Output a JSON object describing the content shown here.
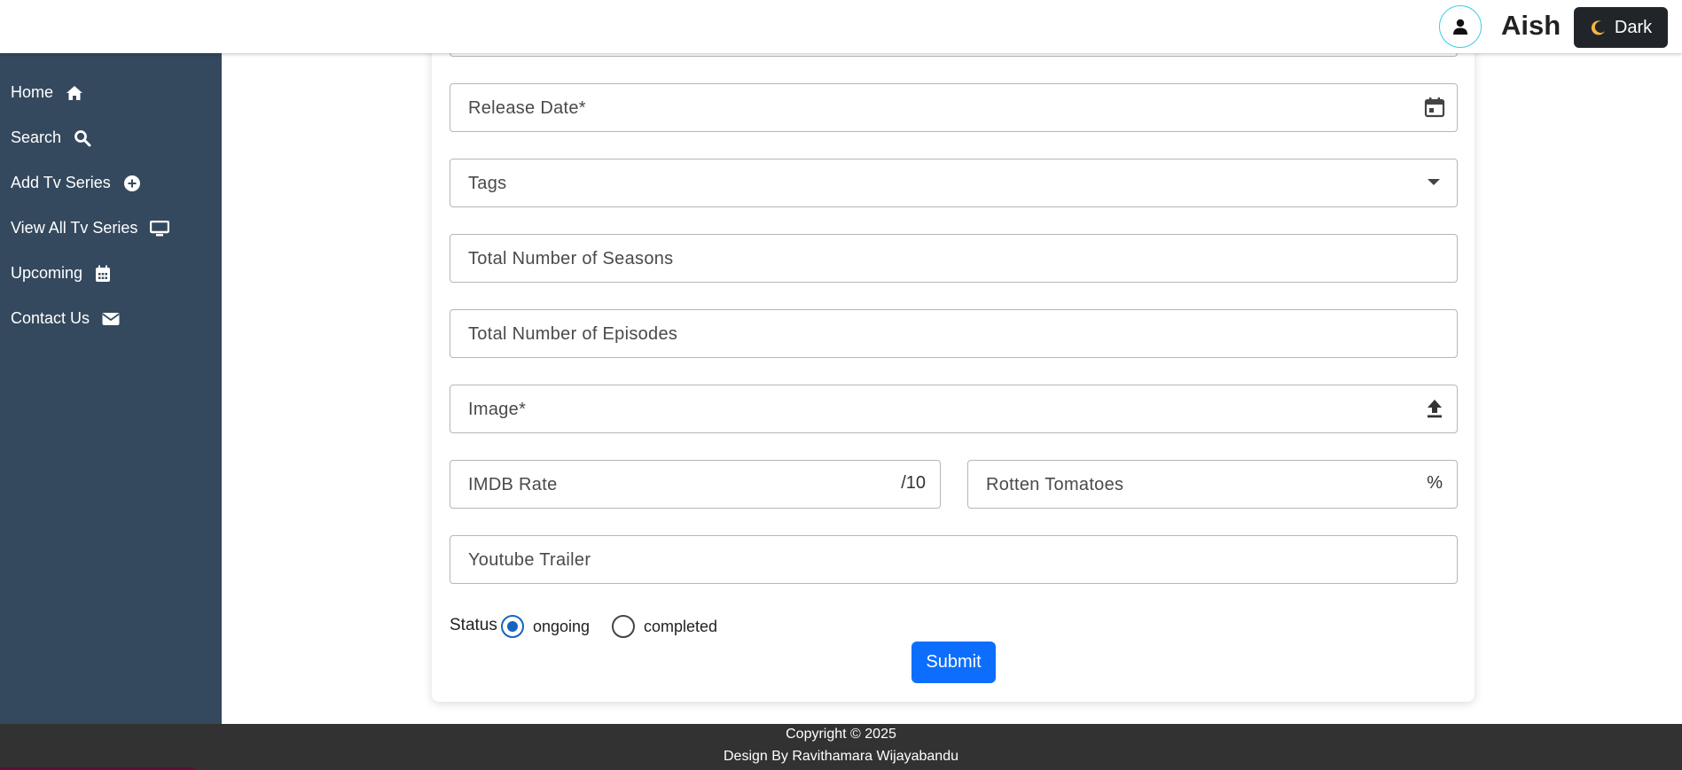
{
  "header": {
    "username": "Aish",
    "theme_button": {
      "icon": "moon-icon",
      "label": "Dark"
    },
    "avatar_icon": "user-icon"
  },
  "sidebar": {
    "items": [
      {
        "label": "Home",
        "icon": "home-icon"
      },
      {
        "label": "Search",
        "icon": "search-icon"
      },
      {
        "label": "Add Tv Series",
        "icon": "plus-circle-icon"
      },
      {
        "label": "View All Tv Series",
        "icon": "monitor-icon"
      },
      {
        "label": "Upcoming",
        "icon": "calendar-icon"
      },
      {
        "label": "Contact Us",
        "icon": "envelope-icon"
      }
    ]
  },
  "form": {
    "release_date": {
      "placeholder": "Release Date*",
      "icon": "calendar-icon"
    },
    "tags": {
      "placeholder": "Tags",
      "icon": "dropdown-arrow-icon"
    },
    "seasons": {
      "placeholder": "Total Number of Seasons"
    },
    "episodes": {
      "placeholder": "Total Number of Episodes"
    },
    "image": {
      "placeholder": "Image*",
      "icon": "upload-icon"
    },
    "imdb": {
      "placeholder": "IMDB Rate",
      "suffix": "/10"
    },
    "rotten": {
      "placeholder": "Rotten Tomatoes",
      "suffix": "%"
    },
    "trailer": {
      "placeholder": "Youtube Trailer"
    },
    "status": {
      "label": "Status",
      "options": [
        "ongoing",
        "completed"
      ],
      "selected": "ongoing"
    },
    "submit_label": "Submit"
  },
  "footer": {
    "copyright": "Copyright © 2025",
    "design_by": "Design By Ravithamara Wijayabandu"
  },
  "colors": {
    "sidebar_bg": "#34495e",
    "primary": "#0d6efd",
    "footer_bg": "#323232",
    "radio_selected": "#1565c0"
  }
}
